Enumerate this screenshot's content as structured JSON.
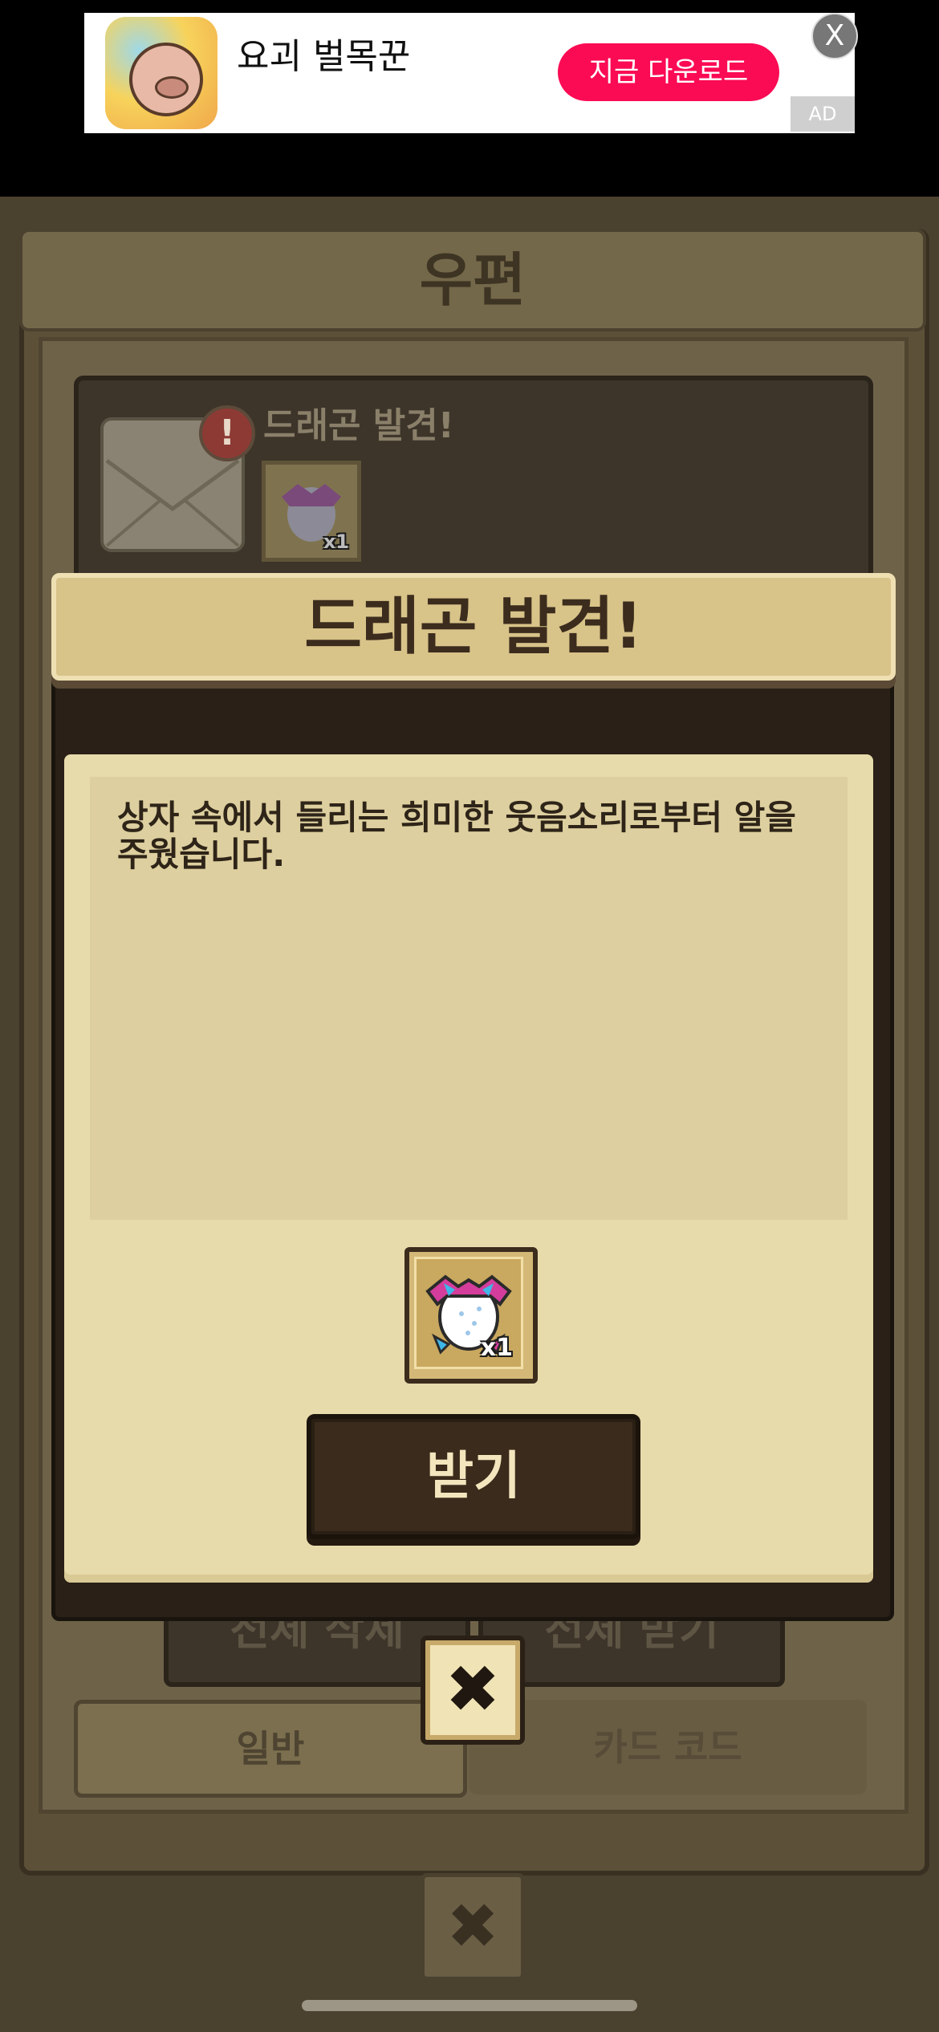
{
  "ad": {
    "app_name": "요괴 벌목꾼",
    "cta": "지금 다운로드",
    "close": "X",
    "badge": "AD"
  },
  "mailbox": {
    "title": "우편",
    "item": {
      "title": "드래곤 발견!",
      "alert": "!",
      "reward_qty": "x1"
    },
    "delete_all": "전체 삭제",
    "receive_all": "전체 받기",
    "tabs": [
      {
        "label": "일반",
        "active": true
      },
      {
        "label": "카드 코드",
        "active": false
      }
    ],
    "close": "✖"
  },
  "modal": {
    "title": "드래곤 발견!",
    "message": "상자 속에서 들리는 희미한 웃음소리로부터 알을 주웠습니다.",
    "reward_qty": "x1",
    "receive_label": "받기",
    "close": "✖"
  },
  "colors": {
    "ad_cta": "#fb0b54",
    "modal_paper": "#e8dbab",
    "modal_header": "#d8c389",
    "button_dark": "#3a2b1c"
  }
}
